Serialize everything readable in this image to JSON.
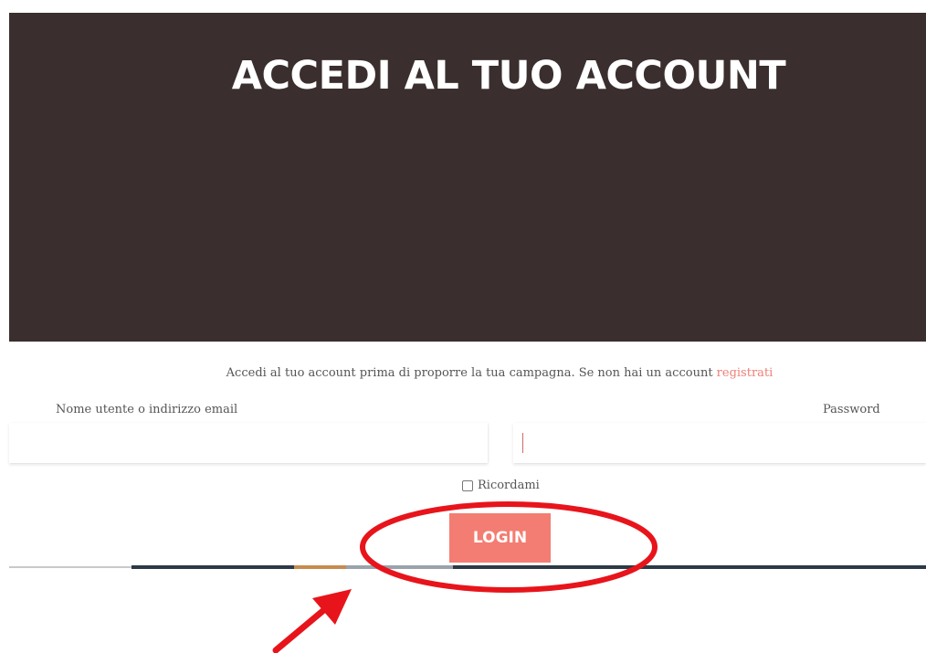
{
  "hero": {
    "title": "ACCEDI AL TUO ACCOUNT"
  },
  "intro": {
    "text": "Accedi al tuo account prima di proporre la tua campagna. Se non hai un account ",
    "link_label": "registrati"
  },
  "form": {
    "username_label": "Nome utente o indirizzo email",
    "username_value": "",
    "password_label": "Password",
    "password_value": "",
    "remember_label": "Ricordami",
    "remember_checked": false,
    "login_label": "LOGIN"
  },
  "colors": {
    "hero_background": "#3a2f2e",
    "accent": "#f37d72",
    "annotation": "#e8141b"
  },
  "annotation": {
    "shapes": [
      "highlight-ellipse",
      "pointer-arrow"
    ]
  }
}
